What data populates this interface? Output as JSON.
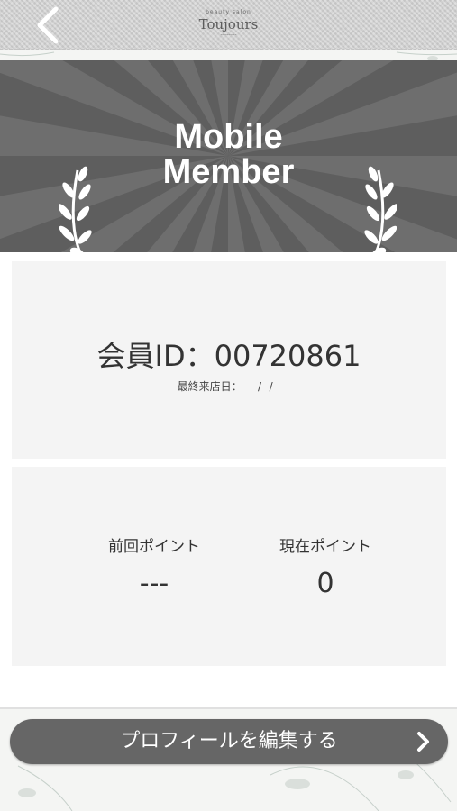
{
  "header": {
    "tagline": "beauty salon",
    "brand": "Toujours",
    "subtitle": "----------",
    "back_icon": "chevron-left-icon"
  },
  "banner": {
    "line1": "Mobile",
    "line2": "Member",
    "left_icon": "laurel-icon",
    "right_icon": "laurel-icon"
  },
  "member": {
    "id_text": "会員ID：00720861",
    "last_visit": "最終来店日：----/--/--"
  },
  "points": {
    "previous_label": "前回ポイント",
    "previous_value": "---",
    "current_label": "現在ポイント",
    "current_value": "0"
  },
  "edit_profile": {
    "label": "プロフィールを編集する",
    "icon": "chevron-right-icon"
  },
  "colors": {
    "banner": "#5e5e5e",
    "button": "#666666",
    "card": "#f4f4f4"
  }
}
